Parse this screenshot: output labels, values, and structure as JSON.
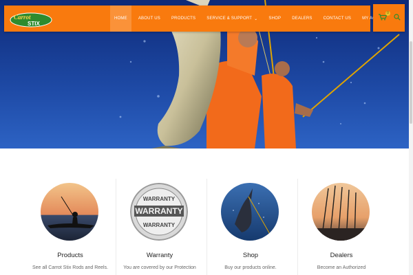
{
  "brand": {
    "logo_text_top": "Carrot",
    "logo_text_bottom": "STIX"
  },
  "nav": {
    "items": [
      {
        "label": "HOME",
        "active": true
      },
      {
        "label": "ABOUT US"
      },
      {
        "label": "PRODUCTS"
      },
      {
        "label": "SERVICE & SUPPORT",
        "dropdown": true
      },
      {
        "label": "SHOP"
      },
      {
        "label": "DEALERS"
      },
      {
        "label": "CONTACT US"
      },
      {
        "label": "MY ACCOUNT",
        "dropdown": true
      }
    ]
  },
  "cart": {
    "count": "0"
  },
  "icons": {
    "cart": "cart-icon",
    "search": "search-icon",
    "dropdown": "chevron-down-icon"
  },
  "colors": {
    "brand_orange": "#f97a0e",
    "badge_yellow": "#e8c22b",
    "logo_green": "#2e8b2e"
  },
  "features": [
    {
      "title": "Products",
      "desc": "See all Carrot Stix Rods and Reels."
    },
    {
      "title": "Warranty",
      "desc": "You are covered by our Protection",
      "badge_top": "WARRANTY",
      "badge_mid": "WARRANTY",
      "badge_bottom": "WARRANTY"
    },
    {
      "title": "Shop",
      "desc": "Buy our products online."
    },
    {
      "title": "Dealers",
      "desc": "Become an Authorized"
    }
  ]
}
